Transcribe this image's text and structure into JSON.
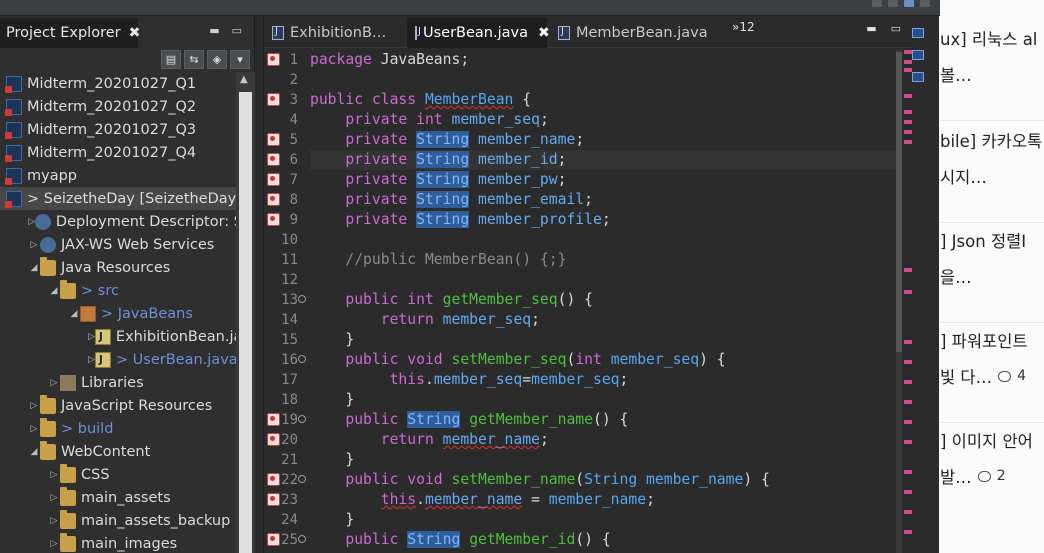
{
  "explorer": {
    "tab_label": "Project Explorer",
    "close_glyph": "✖",
    "items": [
      {
        "label": "Midterm_20201027_Q1",
        "indent": 0,
        "twisty": "",
        "icon": "project-icon"
      },
      {
        "label": "Midterm_20201027_Q2",
        "indent": 0,
        "twisty": "",
        "icon": "project-icon"
      },
      {
        "label": "Midterm_20201027_Q3",
        "indent": 0,
        "twisty": "",
        "icon": "project-icon"
      },
      {
        "label": "Midterm_20201027_Q4",
        "indent": 0,
        "twisty": "",
        "icon": "project-icon"
      },
      {
        "label": "myapp",
        "indent": 0,
        "twisty": "",
        "icon": "project-icon"
      },
      {
        "label": "> SeizetheDay [SeizetheDay m",
        "indent": 0,
        "twisty": "",
        "icon": "project-icon",
        "selected": true
      },
      {
        "label": "Deployment Descriptor: Seiz",
        "indent": 1,
        "twisty": "▷",
        "icon": "descriptor-icon"
      },
      {
        "label": "JAX-WS Web Services",
        "indent": 1,
        "twisty": "▷",
        "icon": "webservice-icon"
      },
      {
        "label": "Java Resources",
        "indent": 1,
        "twisty": "◢",
        "icon": "java-resources-icon"
      },
      {
        "label": "> src",
        "indent": 2,
        "twisty": "◢",
        "icon": "folder-icon",
        "pkg": true
      },
      {
        "label": "> JavaBeans",
        "indent": 3,
        "twisty": "◢",
        "icon": "package-icon",
        "pkg": true
      },
      {
        "label": "ExhibitionBean.java",
        "indent": 4,
        "twisty": "▷",
        "icon": "java-file-icon"
      },
      {
        "label": "> UserBean.java",
        "indent": 4,
        "twisty": "▷",
        "icon": "java-file-icon",
        "pkg": true
      },
      {
        "label": "Libraries",
        "indent": 2,
        "twisty": "▷",
        "icon": "library-icon"
      },
      {
        "label": "JavaScript Resources",
        "indent": 1,
        "twisty": "▷",
        "icon": "js-resources-icon"
      },
      {
        "label": "> build",
        "indent": 1,
        "twisty": "▷",
        "icon": "folder-icon",
        "pkg": true
      },
      {
        "label": "WebContent",
        "indent": 1,
        "twisty": "◢",
        "icon": "folder-icon"
      },
      {
        "label": "CSS",
        "indent": 2,
        "twisty": "▷",
        "icon": "folder-icon"
      },
      {
        "label": "main_assets",
        "indent": 2,
        "twisty": "▷",
        "icon": "folder-icon"
      },
      {
        "label": "main_assets_backup",
        "indent": 2,
        "twisty": "▷",
        "icon": "folder-icon"
      },
      {
        "label": "main_images",
        "indent": 2,
        "twisty": "▷",
        "icon": "folder-icon"
      }
    ]
  },
  "editor": {
    "tabs": [
      {
        "label": "ExhibitionB…",
        "active": false
      },
      {
        "label": "UserBean.java",
        "active": true
      },
      {
        "label": "MemberBean.java",
        "active": false
      }
    ],
    "overflow": "»12",
    "tab_close_glyph": "✖",
    "lines": [
      {
        "n": "1",
        "err": true,
        "html": "<span class='kw'>package</span> JavaBeans;"
      },
      {
        "n": "2",
        "html": ""
      },
      {
        "n": "3",
        "err": true,
        "html": "<span class='kw'>public</span> <span class='kw'>class</span> <span class='cls'>MemberBean</span> {"
      },
      {
        "n": "4",
        "html": "    <span class='kw'>private</span> <span class='kw'>int</span> <span class='fld'>member_seq</span>;"
      },
      {
        "n": "5",
        "err": true,
        "html": "    <span class='kw'>private</span> <span class='hl'>String</span> <span class='fld'>member_name</span>;"
      },
      {
        "n": "6",
        "err": true,
        "cur": true,
        "html": "    <span class='kw'>private</span> <span class='hl'>String</span> <span class='fld'>member_id</span>;"
      },
      {
        "n": "7",
        "err": true,
        "html": "    <span class='kw'>private</span> <span class='hl'>String</span> <span class='fld'>member_pw</span>;"
      },
      {
        "n": "8",
        "err": true,
        "html": "    <span class='kw'>private</span> <span class='hl'>String</span> <span class='fld'>member_email</span>;"
      },
      {
        "n": "9",
        "err": true,
        "html": "    <span class='kw'>private</span> <span class='hl'>String</span> <span class='fld'>member_profile</span>;"
      },
      {
        "n": "10",
        "html": ""
      },
      {
        "n": "11",
        "html": "    <span class='cmt'>//public MemberBean() {;}</span>"
      },
      {
        "n": "12",
        "html": ""
      },
      {
        "n": "13",
        "fold": true,
        "html": "    <span class='kw'>public</span> <span class='kw'>int</span> <span class='mth'>getMember_seq</span>() {"
      },
      {
        "n": "14",
        "html": "        <span class='kw'>return</span> <span class='fld'>member_seq</span>;"
      },
      {
        "n": "15",
        "html": "    }"
      },
      {
        "n": "16",
        "fold": true,
        "html": "    <span class='kw'>public</span> <span class='kw'>void</span> <span class='mth'>setMember_seq</span>(<span class='kw'>int</span> <span class='clsplain'>member_seq</span>) {"
      },
      {
        "n": "17",
        "html": "         <span class='kw'>this</span>.<span class='fld'>member_seq</span>=<span class='clsplain'>member_seq</span>;"
      },
      {
        "n": "18",
        "html": "    }"
      },
      {
        "n": "19",
        "err": true,
        "fold": true,
        "html": "    <span class='kw'>public</span> <span class='hl'>String</span> <span class='mth'>getMember_name</span>() {"
      },
      {
        "n": "20",
        "err": true,
        "html": "        <span class='kw'>return</span> <span class='fld squig'>member_name</span>;"
      },
      {
        "n": "21",
        "html": "    }"
      },
      {
        "n": "22",
        "err": true,
        "fold": true,
        "html": "    <span class='kw'>public</span> <span class='kw'>void</span> <span class='mth'>setMember_name</span>(<span class='clsplain'>String</span> <span class='clsplain'>member_name</span>) {"
      },
      {
        "n": "23",
        "err": true,
        "html": "        <span class='kw squig'>this</span>.<span class='fld squig'>member_name</span> = <span class='clsplain'>member_name</span>;"
      },
      {
        "n": "24",
        "html": "    }"
      },
      {
        "n": "25",
        "err": true,
        "fold": true,
        "html": "    <span class='kw'>public</span> <span class='hl'>String</span> <span class='mth'>getMember_id</span>() {"
      }
    ]
  },
  "web_panel": {
    "items": [
      {
        "title": "ux] 리눅스 al",
        "sub": "볼…",
        "count": ""
      },
      {
        "title": "bile] 카카오톡",
        "sub": "시지…",
        "count": ""
      },
      {
        "title": "] Json 정렬I",
        "sub": "을…",
        "count": ""
      },
      {
        "title": "] 파워포인트",
        "sub": "빛 다…",
        "count": "4"
      },
      {
        "title": "] 이미지 안어",
        "sub": "발…",
        "count": "2"
      }
    ]
  }
}
